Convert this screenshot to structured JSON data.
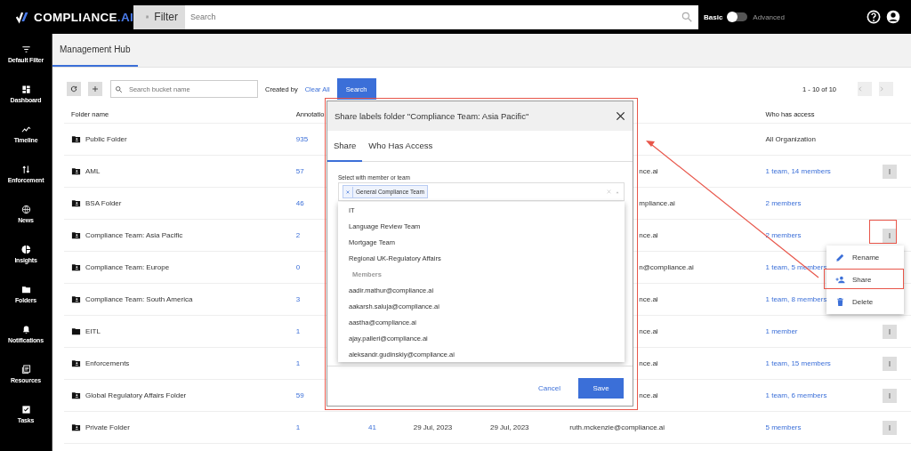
{
  "topbar": {
    "logo": {
      "name": "COMPLIANCE",
      "suffix": ".AI"
    },
    "filter_button": "Filter",
    "search": {
      "placeholder": "Search"
    },
    "mode_toggle": {
      "left_label": "Basic",
      "right_label": "Advanced",
      "on": false
    }
  },
  "sidebar": {
    "items": [
      {
        "label": "Default Filter"
      },
      {
        "label": "Dashboard"
      },
      {
        "label": "Timeline"
      },
      {
        "label": "Enforcement"
      },
      {
        "label": "News"
      },
      {
        "label": "Insights"
      },
      {
        "label": "Folders"
      },
      {
        "label": "Notifications"
      },
      {
        "label": "Resources"
      },
      {
        "label": "Tasks"
      }
    ]
  },
  "page_tab": {
    "label": "Management Hub",
    "selected": true
  },
  "toolbar": {
    "search": {
      "placeholder": "Search bucket name"
    },
    "created_by": "Created by",
    "clear_all": "Clear All",
    "search_button": "Search",
    "pagination": "1 - 10 of 10"
  },
  "table": {
    "columns": [
      "Folder name",
      "Annotatio",
      "",
      "",
      "",
      "",
      "Who has access"
    ],
    "rows": [
      {
        "name": "Public Folder",
        "shared": true,
        "annotations": "935",
        "access": "All Organization",
        "access_link": false,
        "menu": false
      },
      {
        "name": "AML",
        "shared": true,
        "annotations": "57",
        "owner": "nce.ai",
        "covered": true,
        "access": "1 team, 14 members",
        "access_link": true,
        "menu": true
      },
      {
        "name": "BSA Folder",
        "shared": true,
        "annotations": "46",
        "owner": "mpliance.ai",
        "covered": true,
        "access": "2 members",
        "access_link": true,
        "menu": false
      },
      {
        "name": "Compliance Team: Asia Pacific",
        "shared": true,
        "annotations": "2",
        "owner": "nce.ai",
        "covered": true,
        "access": "2 members",
        "access_link": true,
        "menu": true
      },
      {
        "name": "Compliance Team: Europe",
        "shared": true,
        "annotations": "0",
        "owner": "n@compliance.ai",
        "covered": true,
        "access": "1 team, 5 members",
        "access_link": true,
        "menu": false
      },
      {
        "name": "Compliance Team: South America",
        "shared": true,
        "annotations": "3",
        "owner": "nce.ai",
        "covered": true,
        "access": "1 team, 8 members",
        "access_link": true,
        "menu": false
      },
      {
        "name": "EITL",
        "shared": false,
        "annotations": "1",
        "owner": "nce.ai",
        "covered": true,
        "access": "1 member",
        "access_link": true,
        "menu": true
      },
      {
        "name": "Enforcements",
        "shared": true,
        "annotations": "1",
        "owner": "nce.ai",
        "covered": true,
        "access": "1 team, 15 members",
        "access_link": true,
        "menu": true
      },
      {
        "name": "Global Regulatory Affairs Folder",
        "shared": true,
        "annotations": "59",
        "owner": "nce.ai",
        "covered": true,
        "access": "1 team, 6 members",
        "access_link": true,
        "menu": true
      },
      {
        "name": "Private Folder",
        "shared": true,
        "annotations": "1",
        "column_3": "41",
        "column_4": "29 Jul, 2023",
        "column_5": "29 Jul, 2023",
        "owner": "ruth.mckenzie@compliance.ai",
        "covered": false,
        "access": "5 members",
        "access_link": true,
        "menu": true
      }
    ]
  },
  "modal": {
    "title": "Share labels folder \"Compliance Team: Asia Pacific\"",
    "tabs": [
      {
        "label": "Share",
        "selected": true
      },
      {
        "label": "Who Has Access",
        "selected": false
      }
    ],
    "field_label": "Select with member or team",
    "chips": [
      "General Compliance Team"
    ],
    "options": [
      {
        "kind": "option",
        "label": "IT"
      },
      {
        "kind": "option",
        "label": "Language Review Team"
      },
      {
        "kind": "option",
        "label": "Mortgage Team"
      },
      {
        "kind": "option",
        "label": "Regional UK-Regulatory Affairs"
      },
      {
        "kind": "group",
        "label": "Members"
      },
      {
        "kind": "option",
        "label": "aadir.mathur@compliance.ai"
      },
      {
        "kind": "option",
        "label": "aakarsh.saluja@compliance.ai"
      },
      {
        "kind": "option",
        "label": "aastha@compliance.ai"
      },
      {
        "kind": "option",
        "label": "ajay.palleri@compliance.ai"
      },
      {
        "kind": "option",
        "label": "aleksandr.gudinskiy@compliance.ai"
      }
    ],
    "cancel": "Cancel",
    "save": "Save"
  },
  "context_menu": {
    "items": [
      {
        "label": "Rename"
      },
      {
        "label": "Share"
      },
      {
        "label": "Delete"
      }
    ]
  }
}
